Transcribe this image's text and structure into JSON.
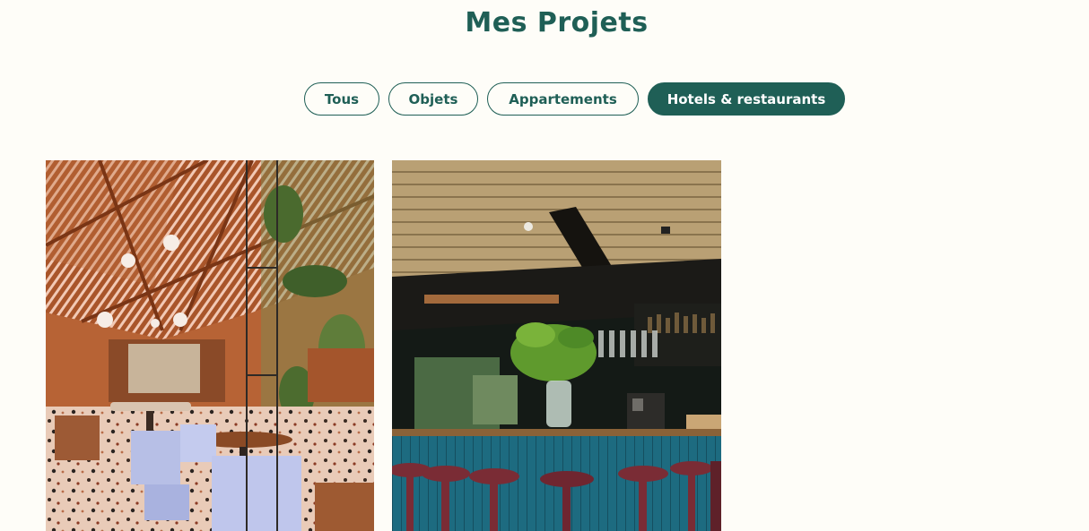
{
  "page": {
    "title": "Mes Projets"
  },
  "filters": {
    "items": [
      {
        "label": "Tous",
        "active": false
      },
      {
        "label": "Objets",
        "active": false
      },
      {
        "label": "Appartements",
        "active": false
      },
      {
        "label": "Hotels & restaurants",
        "active": true
      }
    ]
  },
  "projects": [
    {
      "image": "restaurant-greenhouse-photo"
    },
    {
      "image": "bar-counter-photo"
    }
  ],
  "colors": {
    "accent": "#1f5f56",
    "background": "#fefdf8"
  }
}
